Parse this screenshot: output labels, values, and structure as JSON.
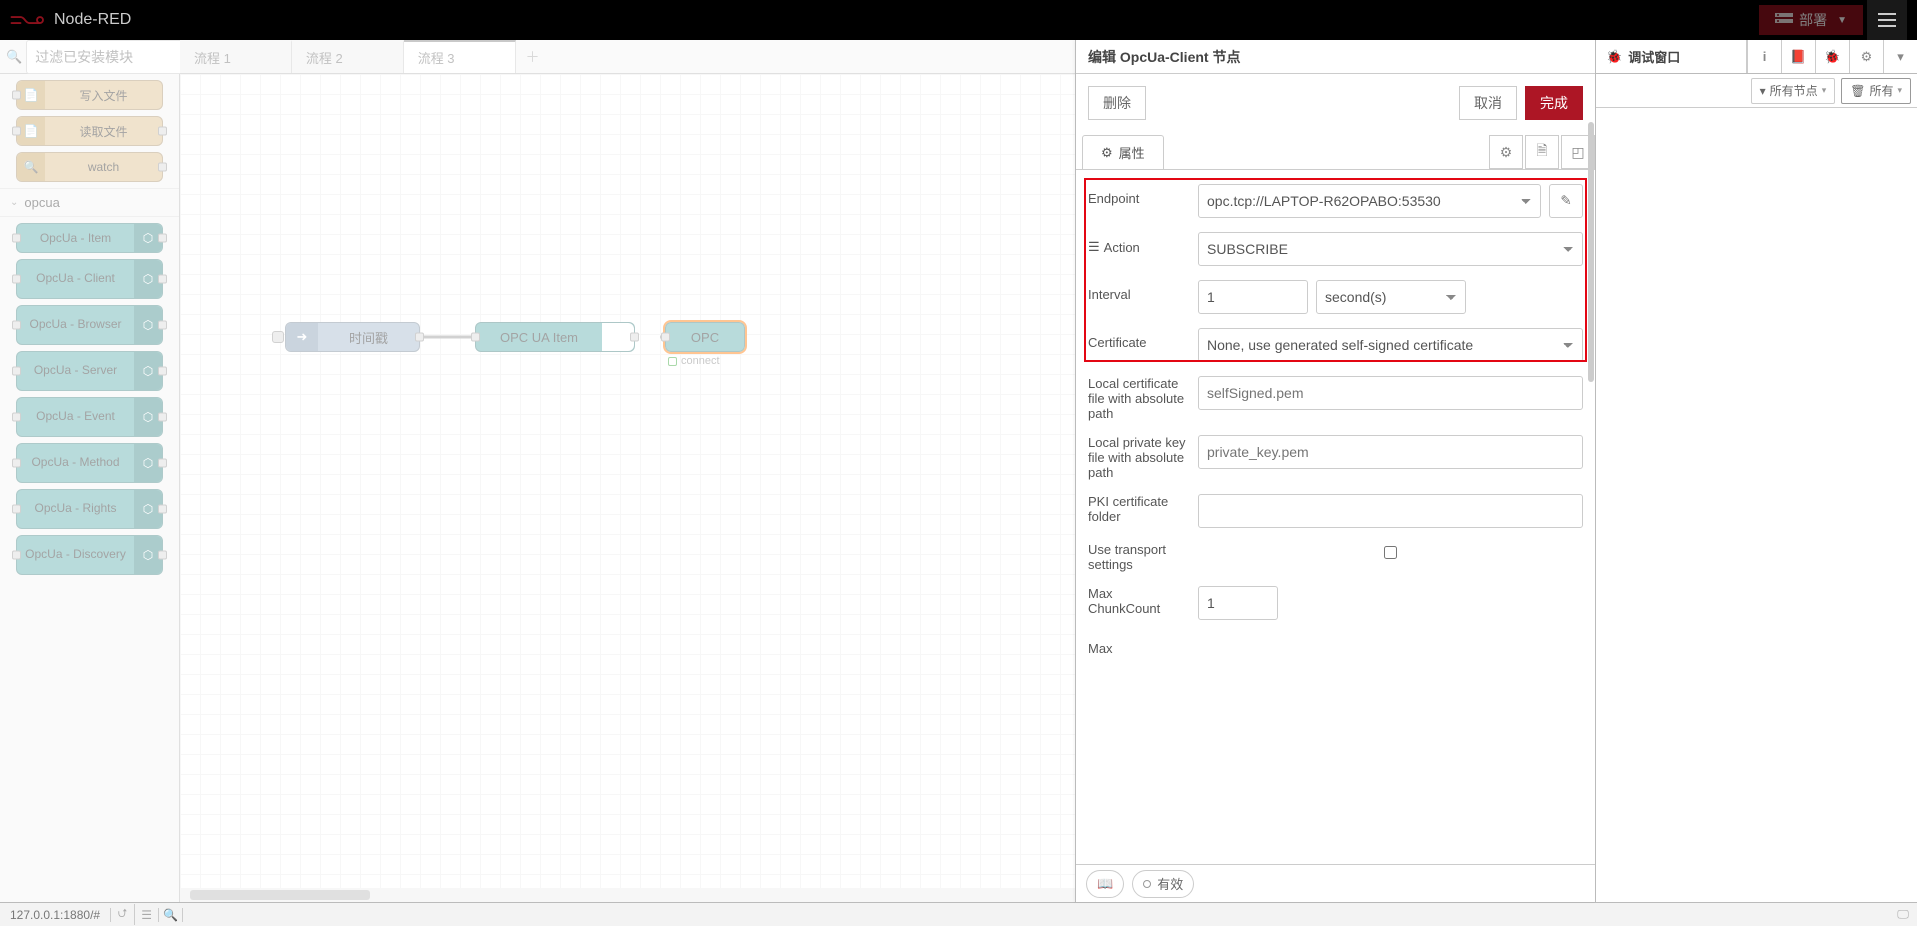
{
  "header": {
    "title": "Node-RED",
    "deploy": "部署"
  },
  "palette": {
    "search_placeholder": "过滤已安装模块",
    "file_nodes": [
      {
        "label": "写入文件"
      },
      {
        "label": "读取文件"
      },
      {
        "label": "watch"
      }
    ],
    "category": "opcua",
    "opcua_nodes": [
      "OpcUa - Item",
      "OpcUa - Client",
      "OpcUa - Browser",
      "OpcUa - Server",
      "OpcUa - Event",
      "OpcUa - Method",
      "OpcUa - Rights",
      "OpcUa - Discovery"
    ]
  },
  "tabs": [
    "流程 1",
    "流程 2",
    "流程 3"
  ],
  "flow": {
    "n1": "时间戳",
    "n2": "OPC UA Item",
    "n3": "OPC",
    "status": "connect"
  },
  "tray": {
    "title": "编辑 OpcUa-Client 节点",
    "delete": "删除",
    "cancel": "取消",
    "done": "完成",
    "prop_tab": "属性",
    "fields": {
      "endpoint_label": "Endpoint",
      "endpoint_value": "opc.tcp://LAPTOP-R62OPABO:53530",
      "action_label": "Action",
      "action_value": "SUBSCRIBE",
      "interval_label": "Interval",
      "interval_value": "1",
      "interval_unit": "second(s)",
      "cert_label": "Certificate",
      "cert_value": "None, use generated self-signed certificate",
      "localcert_label": "Local certificate file with absolute path",
      "localcert_ph": "selfSigned.pem",
      "localkey_label": "Local private key file with absolute path",
      "localkey_ph": "private_key.pem",
      "pki_label": "PKI certificate folder",
      "transport_label": "Use transport settings",
      "maxchunk_label": "Max ChunkCount",
      "maxchunk_value": "1",
      "more": "Max"
    },
    "footer_valid": "有效"
  },
  "sidebar": {
    "tab": "调试窗口",
    "filter": "所有节点",
    "clear": "所有"
  },
  "footer": {
    "url": "127.0.0.1:1880/#"
  }
}
